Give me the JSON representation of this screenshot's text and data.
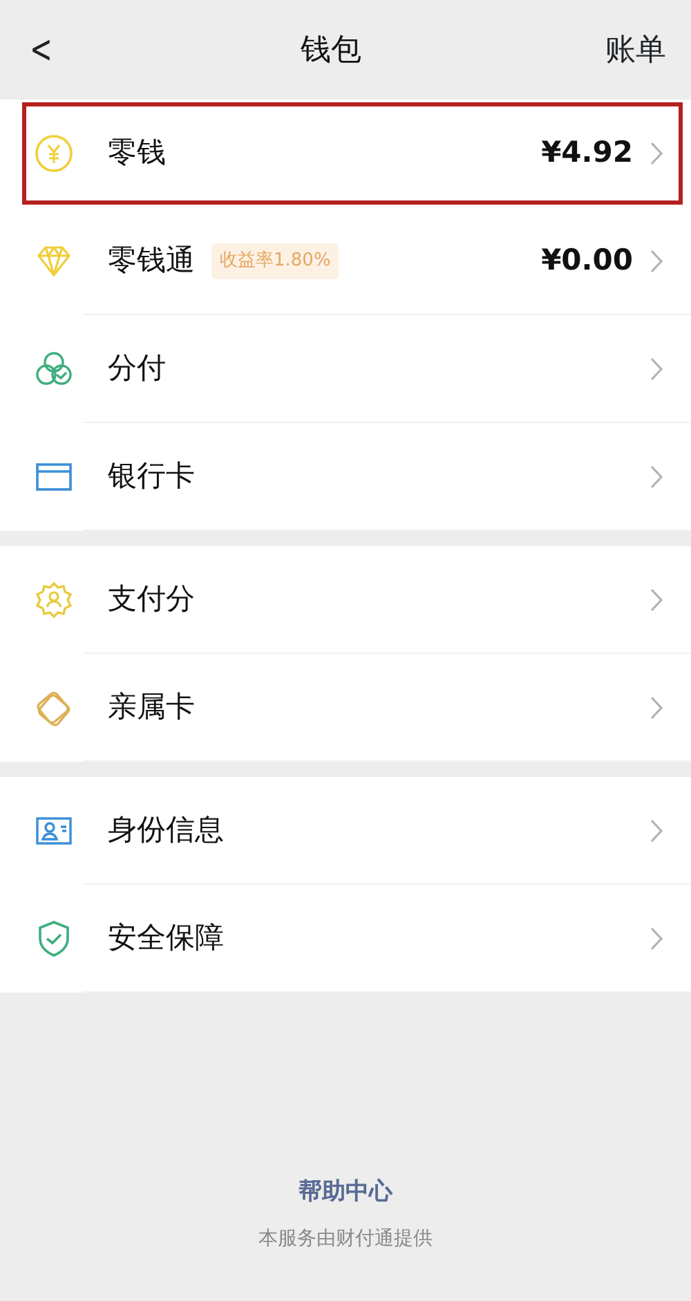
{
  "header": {
    "back": "<",
    "title": "钱包",
    "action": "账单"
  },
  "groups": [
    {
      "items": [
        {
          "label": "零钱",
          "value": "¥4.92",
          "highlighted": true
        },
        {
          "label": "零钱通",
          "badge": "收益率1.80%",
          "value": "¥0.00",
          "highlighted": false
        },
        {
          "label": "分付",
          "highlighted": false
        },
        {
          "label": "银行卡",
          "highlighted": false
        }
      ]
    },
    {
      "items": [
        {
          "label": "支付分",
          "highlighted": false
        },
        {
          "label": "亲属卡",
          "highlighted": false
        }
      ]
    },
    {
      "items": [
        {
          "label": "身份信息",
          "highlighted": false
        },
        {
          "label": "安全保障",
          "highlighted": false
        }
      ]
    }
  ],
  "footer": {
    "link": "帮助中心",
    "note": "本服务由财付通提供"
  }
}
